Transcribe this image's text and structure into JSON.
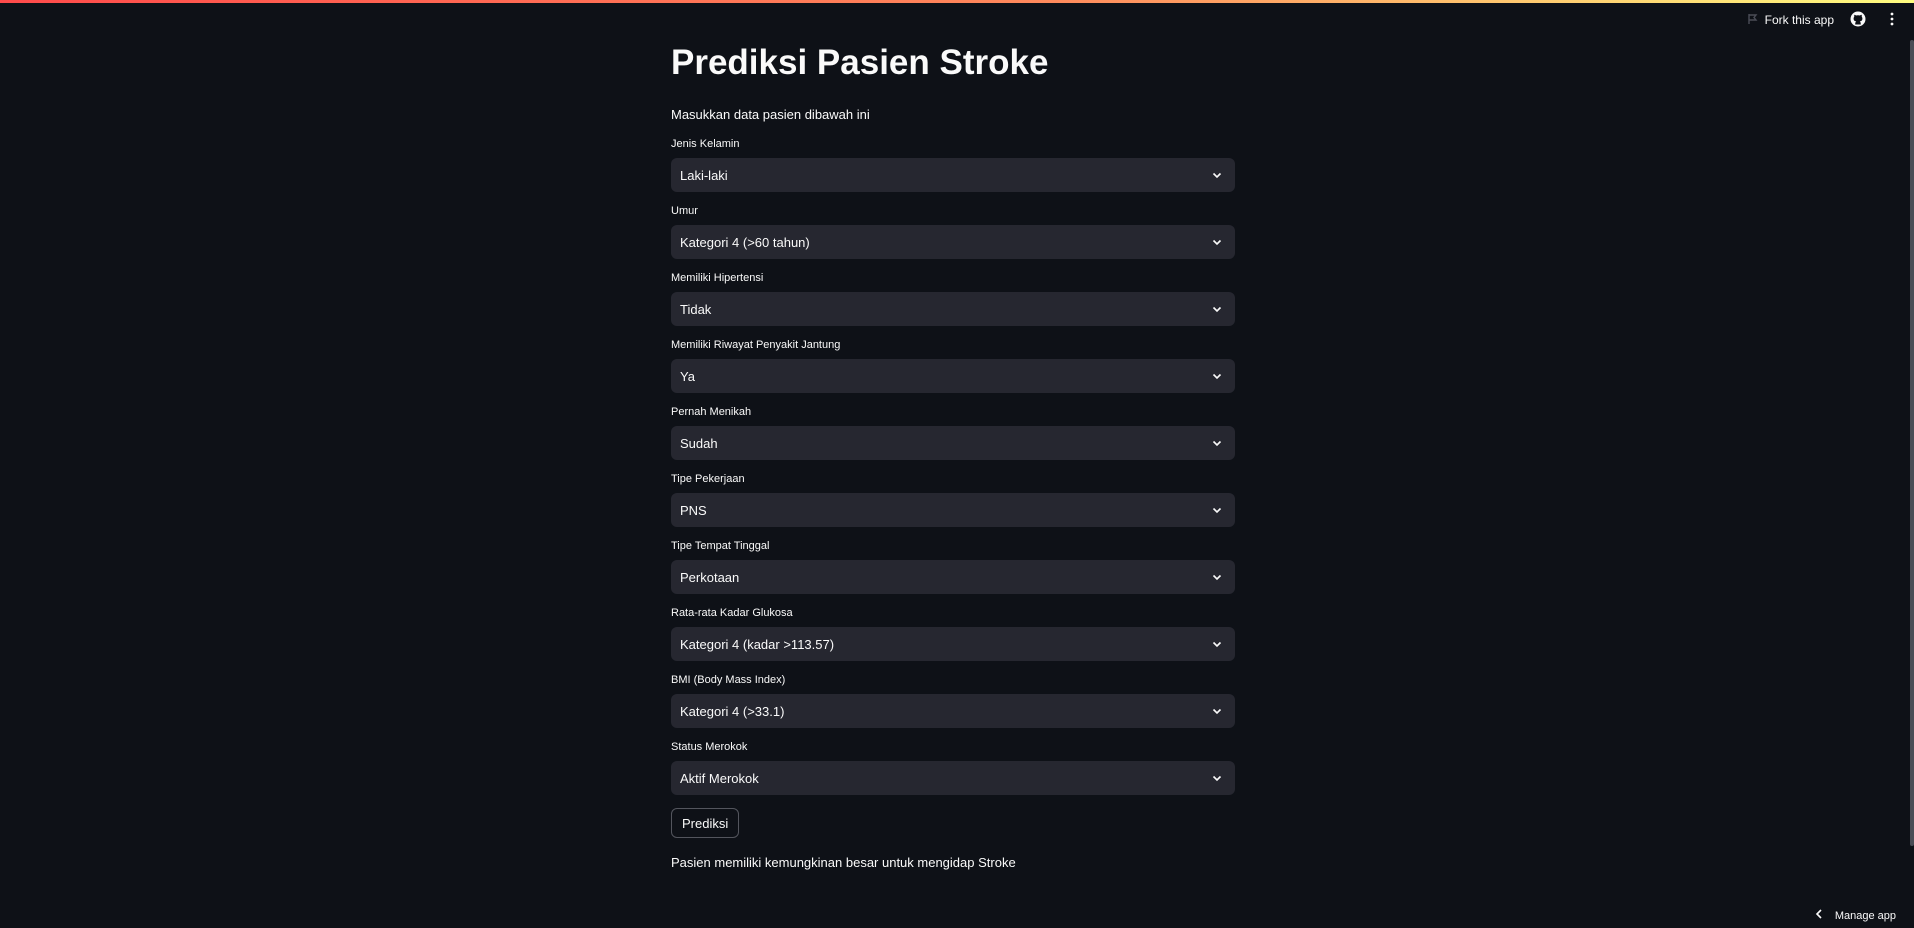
{
  "header": {
    "fork_label": "Fork this app",
    "icons": [
      "fork-icon",
      "github-icon",
      "kebab-menu-icon"
    ]
  },
  "page": {
    "title": "Prediksi Pasien Stroke",
    "subtitle": "Masukkan data pasien dibawah ini"
  },
  "fields": [
    {
      "label": "Jenis Kelamin",
      "value": "Laki-laki"
    },
    {
      "label": "Umur",
      "value": "Kategori 4 (>60 tahun)"
    },
    {
      "label": "Memiliki Hipertensi",
      "value": "Tidak"
    },
    {
      "label": "Memiliki Riwayat Penyakit Jantung",
      "value": "Ya"
    },
    {
      "label": "Pernah Menikah",
      "value": "Sudah"
    },
    {
      "label": "Tipe Pekerjaan",
      "value": "PNS"
    },
    {
      "label": "Tipe Tempat Tinggal",
      "value": "Perkotaan"
    },
    {
      "label": "Rata-rata Kadar Glukosa",
      "value": "Kategori 4 (kadar >113.57)"
    },
    {
      "label": "BMI (Body Mass Index)",
      "value": "Kategori 4 (>33.1)"
    },
    {
      "label": "Status Merokok",
      "value": "Aktif Merokok"
    }
  ],
  "actions": {
    "predict_label": "Prediksi"
  },
  "result": {
    "text": "Pasien memiliki kemungkinan besar untuk mengidap Stroke"
  },
  "footer": {
    "manage_label": "Manage app"
  },
  "colors": {
    "background": "#0e1117",
    "select_bg": "#262730",
    "text": "#fafafa",
    "accent_start": "#ff4b4b",
    "accent_end": "#fffd80"
  }
}
